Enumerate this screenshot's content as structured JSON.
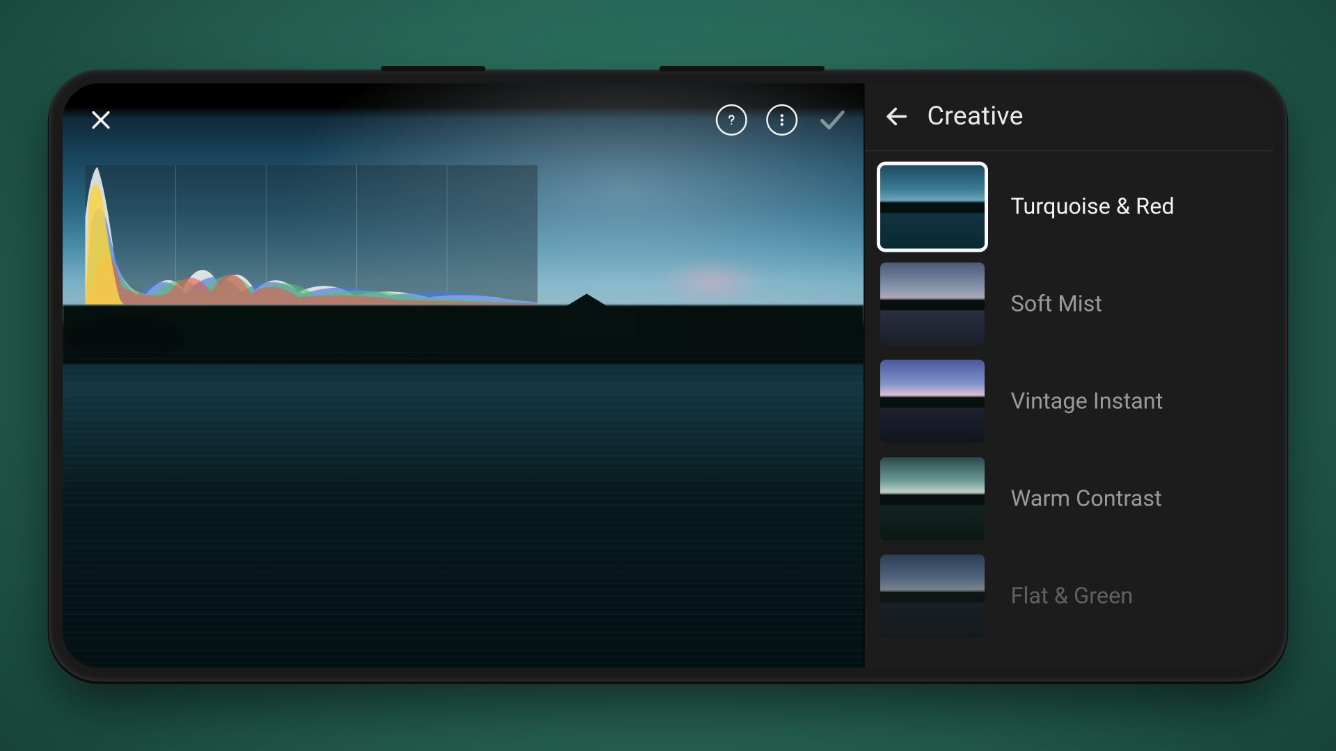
{
  "panel": {
    "title": "Creative",
    "presets": [
      {
        "label": "Turquoise & Red",
        "selected": true,
        "swatch": "t1"
      },
      {
        "label": "Soft Mist",
        "selected": false,
        "swatch": "t2"
      },
      {
        "label": "Vintage Instant",
        "selected": false,
        "swatch": "t3"
      },
      {
        "label": "Warm Contrast",
        "selected": false,
        "swatch": "t4"
      },
      {
        "label": "Flat & Green",
        "selected": false,
        "swatch": "t5"
      }
    ]
  },
  "toolbar": {
    "close": "Close",
    "help": "Help",
    "more": "More options",
    "confirm": "Confirm"
  },
  "colors": {
    "accent": "#ffffff",
    "panel_bg": "#1c1c1c",
    "text_primary": "#f2f2f2",
    "text_secondary": "#9a9a9a"
  }
}
